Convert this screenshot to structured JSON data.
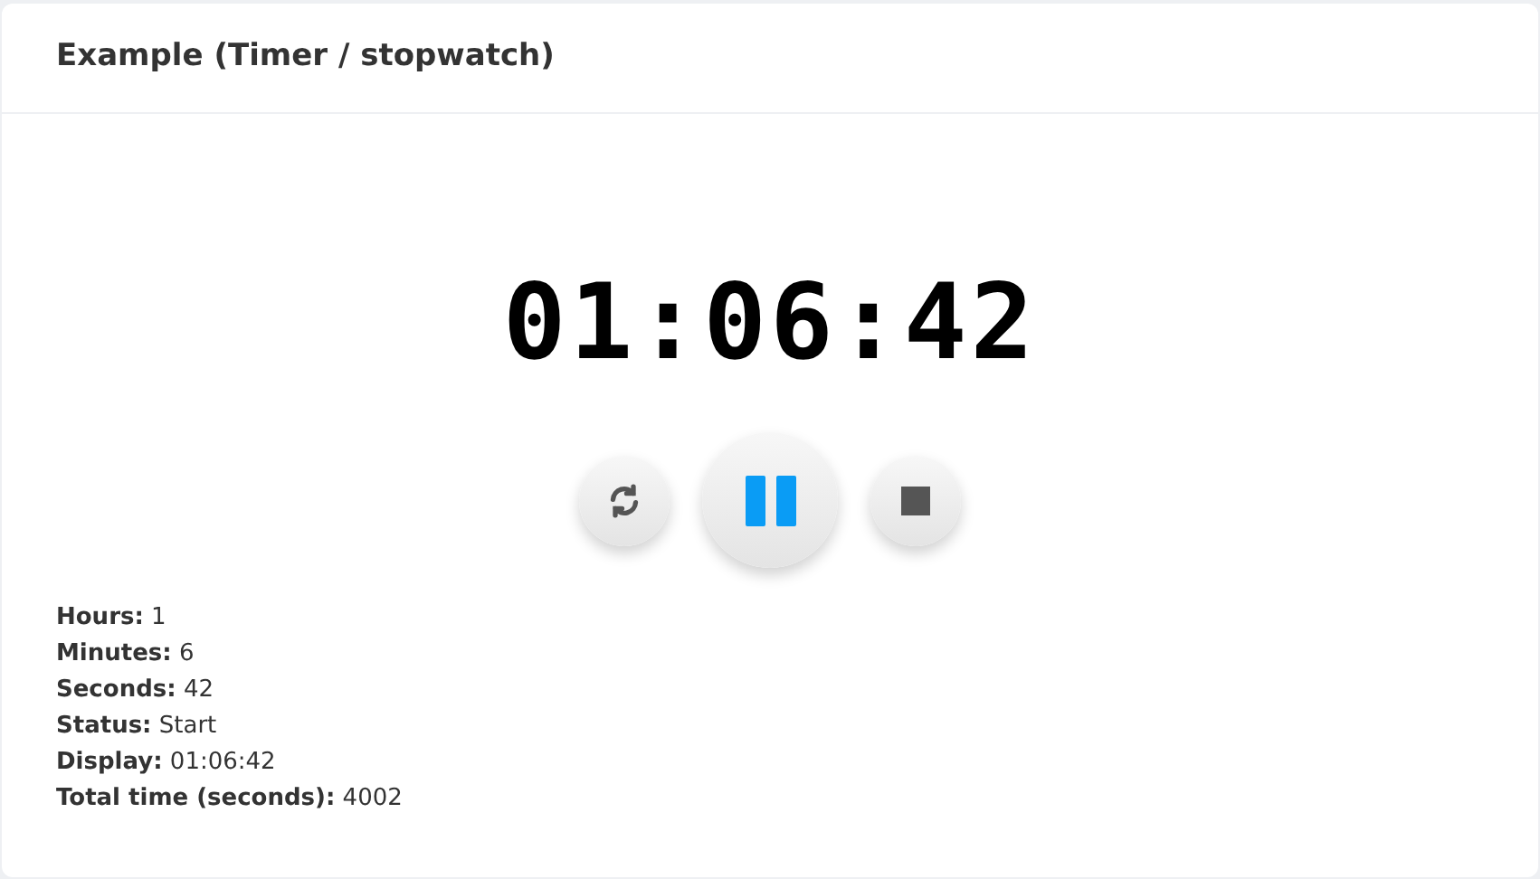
{
  "card": {
    "title": "Example (Timer / stopwatch)"
  },
  "timer": {
    "display": "01:06:42"
  },
  "controls": [
    {
      "kind": "reset"
    },
    {
      "kind": "pause"
    },
    {
      "kind": "stop"
    }
  ],
  "info": [
    "**Hours:** 1",
    "**Minutes:** 6",
    "**Seconds:** 42",
    "**Status:** Start",
    "**Display:** 01:06:42",
    "**Total time (seconds):** 4002"
  ]
}
